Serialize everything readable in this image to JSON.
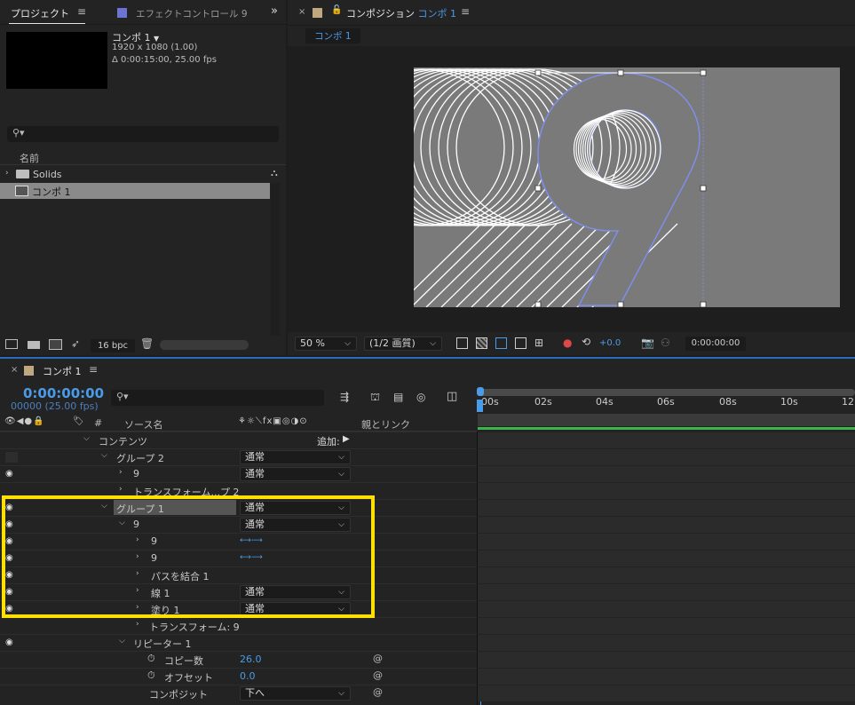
{
  "project_panel": {
    "tab_label": "プロジェクト",
    "effects_tab_label": "エフェクトコントロール 9",
    "comp_name": "コンポ 1",
    "comp_resolution": "1920 x 1080 (1.00)",
    "comp_duration": "Δ 0:00:15:00, 25.00 fps",
    "search_placeholder": "",
    "name_header": "名前",
    "items": [
      {
        "label": "Solids"
      },
      {
        "label": "コンポ 1"
      }
    ],
    "bpc_label": "16 bpc"
  },
  "composition_panel": {
    "title": "コンポジション",
    "title_comp": "コンポ 1",
    "tab_label": "コンポ 1",
    "zoom": "50 %",
    "quality": "(1/2 画質)",
    "exposure": "+0.0",
    "timecode": "0:00:00:00",
    "glyph": "9"
  },
  "timeline": {
    "tab_label": "コンポ 1",
    "timecode": "0:00:00:00",
    "frame_info": "00000 (25.00 fps)",
    "header_source": "ソース名",
    "header_parent": "親とリンク",
    "header_hash": "#",
    "ruler_ticks": [
      "00s",
      "02s",
      "04s",
      "06s",
      "08s",
      "10s",
      "12"
    ],
    "rows": [
      {
        "label": "コンテンツ",
        "add_label": "追加:"
      },
      {
        "label": "グループ 2",
        "mode": "通常"
      },
      {
        "label": "9",
        "mode": "通常"
      },
      {
        "label": "トランスフォーム...プ 2"
      },
      {
        "label": "グループ 1",
        "mode": "通常"
      },
      {
        "label": "9",
        "mode": "通常"
      },
      {
        "label": "9"
      },
      {
        "label": "9"
      },
      {
        "label": "パスを結合 1"
      },
      {
        "label": "線 1",
        "mode": "通常"
      },
      {
        "label": "塗り 1",
        "mode": "通常"
      },
      {
        "label": "トランスフォーム: 9"
      },
      {
        "label": "リピーター 1"
      },
      {
        "label": "コピー数",
        "value": "26.0"
      },
      {
        "label": "オフセット",
        "value": "0.0"
      },
      {
        "label": "コンポジット",
        "mode": "下へ"
      }
    ]
  },
  "colors": {
    "highlight": "#ffe000",
    "accent_blue": "#4a9be8",
    "work_area_green": "#3bb64a",
    "comp_bg": "#7a7a7a"
  }
}
